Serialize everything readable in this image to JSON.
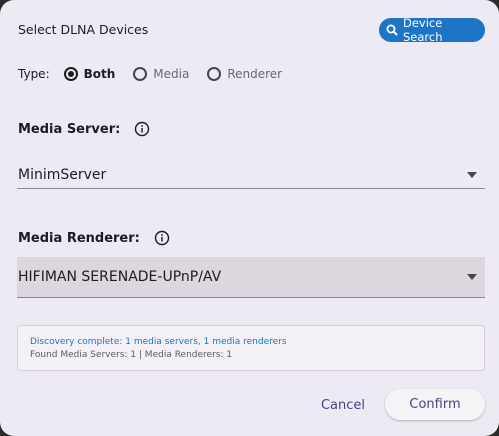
{
  "dialog": {
    "title": "Select DLNA Devices",
    "search_button": {
      "label": "Device Search",
      "icon": "search-icon"
    },
    "type": {
      "label": "Type:",
      "options": [
        {
          "label": "Both",
          "selected": true
        },
        {
          "label": "Media",
          "selected": false
        },
        {
          "label": "Renderer",
          "selected": false
        }
      ]
    },
    "media_server": {
      "label": "Media Server:",
      "icon": "info-icon",
      "value": "MinimServer"
    },
    "media_renderer": {
      "label": "Media Renderer:",
      "icon": "info-icon",
      "value": "HIFIMAN SERENADE-UPnP/AV"
    },
    "status": {
      "line1": "Discovery complete: 1 media servers, 1 media renderers",
      "line2": "Found Media Servers: 1 | Media Renderers: 1"
    },
    "actions": {
      "cancel": "Cancel",
      "confirm": "Confirm"
    }
  },
  "colors": {
    "background": "#eeeaf3",
    "accent": "#1e74c7",
    "button_text": "#4a3f87"
  }
}
